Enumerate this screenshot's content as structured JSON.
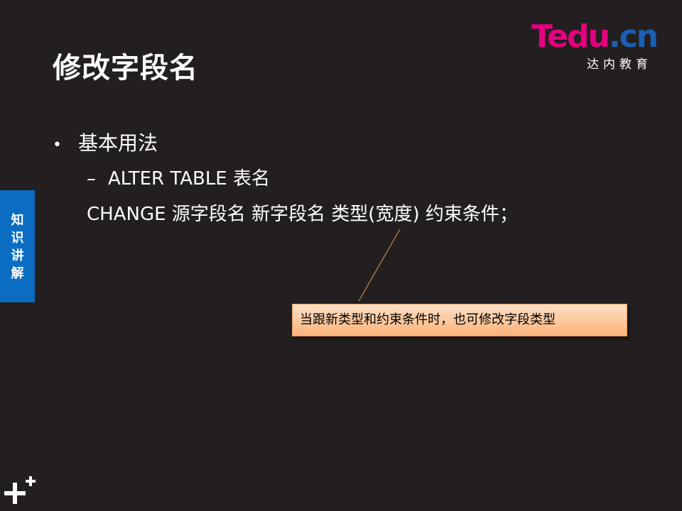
{
  "title": "修改字段名",
  "logo": {
    "brand_t": "T",
    "brand_edu": "edu",
    "brand_dot": ".",
    "brand_cn": "cn",
    "subtitle": "达内教育",
    "colors": {
      "magenta": "#e4007f",
      "blue": "#1a5fb4"
    }
  },
  "side_tab": {
    "chars": [
      "知",
      "识",
      "讲",
      "解"
    ],
    "color": "#0a6dc2"
  },
  "content": {
    "bullet_1": "基本用法",
    "bullet_2": "ALTER TABLE  表名",
    "bullet_2_cont": "CHANGE 源字段名  新字段名  类型(宽度)  约束条件；"
  },
  "callout": {
    "text": "当跟新类型和约束条件时，也可修改字段类型"
  },
  "icons": {
    "bullet_dot": "•",
    "bullet_dash": "–",
    "corner": "plus-icon"
  },
  "colors": {
    "background": "#231f20",
    "text": "#ffffff"
  }
}
